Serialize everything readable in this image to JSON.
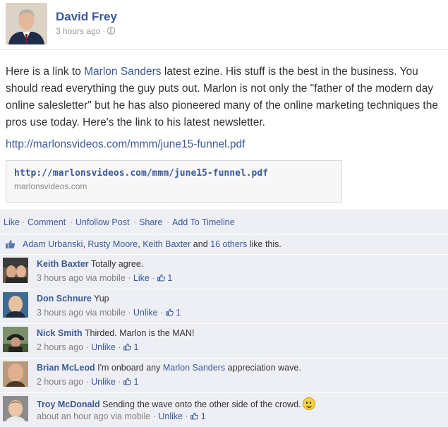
{
  "post": {
    "author": "David Frey",
    "time": "3 hours ago",
    "meta_dot": "·",
    "globe_icon": "globe-icon",
    "text_before": "Here is a link to ",
    "text_link": "Marlon Sanders",
    "text_after": " latest ezine. His stuff is the best in the business. You should read everything the guy puts out. Marlon is not only the \"father of the modern day online salesletter\" but he has also pioneered many of the online marketing techniques the pros use today. Here's the link to his latest newsletter.",
    "url": "http://marlonsvideos.com/mmm/june15-funnel.pdf"
  },
  "share": {
    "title": "http://marlonsvideos.com/mmm/june15-funnel.pdf",
    "domain": "marlonsvideos.com"
  },
  "actions": {
    "like": "Like",
    "comment": "Comment",
    "unfollow": "Unfollow Post",
    "share": "Share",
    "timeline": "Add To Timeline",
    "dot": "·"
  },
  "likes": {
    "p1": "Adam Urbanski",
    "sep1": ", ",
    "p2": "Rusty Moore",
    "sep2": ", ",
    "p3": "Keith Baxter",
    "and": " and ",
    "others": "16 others",
    "tail": " like this."
  },
  "comments": [
    {
      "author": "Keith Baxter",
      "text": "Totally agree.",
      "time": "3 hours ago via mobile",
      "action": "Like",
      "count": "1"
    },
    {
      "author": "Don Schnure",
      "text": "Yup",
      "time": "3 hours ago via mobile",
      "action": "Unlike",
      "count": "1"
    },
    {
      "author": "Nick Smith",
      "text": "Thirded. Marlon is the MAN!",
      "time": "2 hours ago",
      "action": "Unlike",
      "count": "1"
    },
    {
      "author": "Brian McLeod",
      "text_before": "I'm onboard any ",
      "text_link": "Marlon Sanders",
      "text_after": " appreciation wave.",
      "time": "2 hours ago",
      "action": "Unlike",
      "count": "1"
    },
    {
      "author": "Troy McDonald",
      "text": "Sending the wave onto the other side of the crowd.",
      "time": "about an hour ago via mobile",
      "action": "Unlike",
      "count": "1"
    }
  ],
  "colors": {
    "link": "#3b5998",
    "panel": "#edeff4"
  }
}
